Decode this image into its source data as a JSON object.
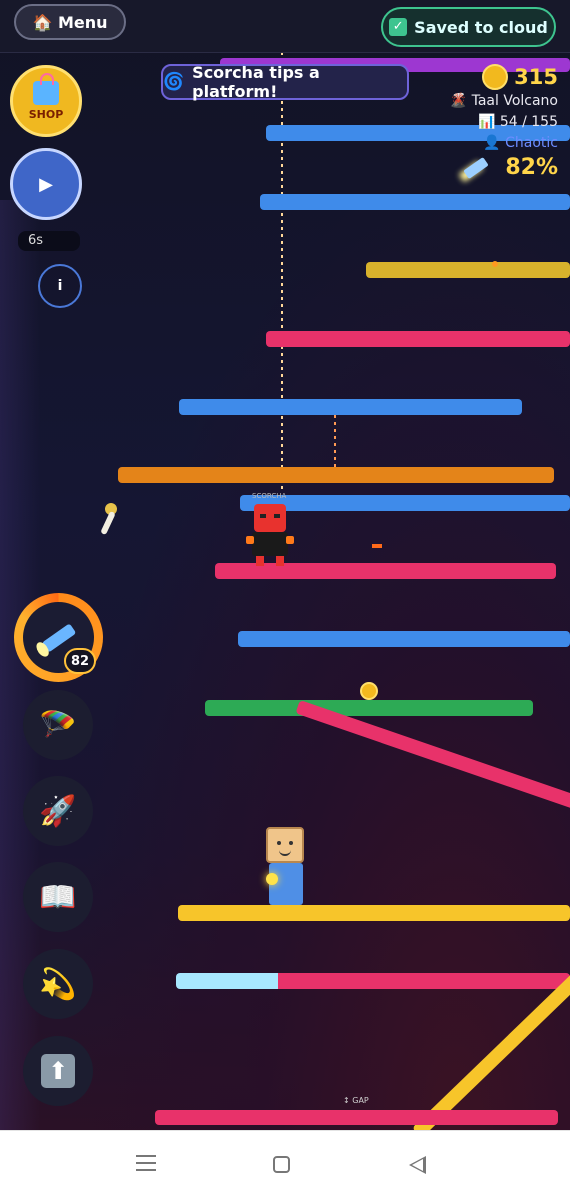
{
  "topbar": {
    "menu_label": "🏠 Menu",
    "saved_label": "Saved to cloud",
    "check_icon": "check-icon"
  },
  "toast": {
    "text": "Scorcha tips a platform!",
    "icon": "spiral-icon"
  },
  "hud": {
    "coins": "315",
    "level_name": "🌋 Taal Volcano",
    "progress": "📊 54 / 155",
    "mode": "👤 Chaotic",
    "torch_percent": "82%"
  },
  "left_controls": {
    "shop_label": "SHOP",
    "play_icon": "play-icon",
    "timer": "6s",
    "info_label": "i",
    "torch_count": "82"
  },
  "powerups": [
    {
      "name": "parachute-icon"
    },
    {
      "name": "rocket-icon"
    },
    {
      "name": "book-icon"
    },
    {
      "name": "star-spin-icon"
    },
    {
      "name": "up-arrow-icon"
    }
  ],
  "scene": {
    "enemy_label": "SCORCHA",
    "gap_label": "↕ GAP"
  },
  "colors": {
    "blue_platform": "#3f8bea",
    "pink_platform": "#e8326a",
    "yellow_platform": "#f7c52a",
    "orange_platform": "#e48419",
    "green_platform": "#2daa55",
    "ice_platform": "#a8e8ff",
    "purple_platform": "#9d37d1"
  }
}
